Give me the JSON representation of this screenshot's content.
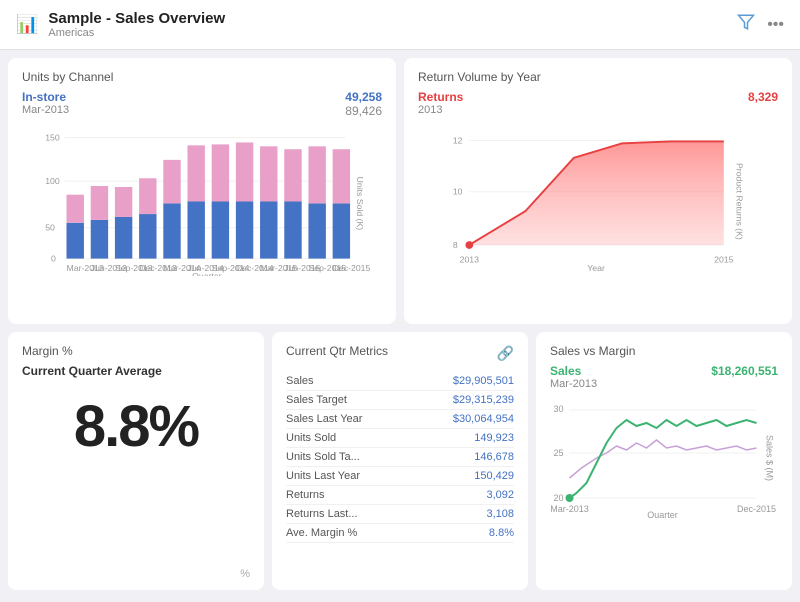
{
  "header": {
    "title": "Sample - Sales Overview",
    "subtitle": "Americas",
    "icon": "📊"
  },
  "unitsChannel": {
    "title": "Units by Channel",
    "series1": "In-store",
    "date1": "Mar-2013",
    "value1": "49,258",
    "value2": "89,426",
    "xLabels": [
      "Mar-2013",
      "Jun-2013",
      "Sep-2013",
      "Dec-2013",
      "Mar-2014",
      "Jun-2014",
      "Sep-2014",
      "Dec-2014",
      "Mar-2015",
      "Jun-2015",
      "Sep-2015",
      "Dec-2015"
    ],
    "yLabel": "Units Sold (K)",
    "xAxisLabel": "Quarter",
    "bars": [
      {
        "blue": 45,
        "pink": 35
      },
      {
        "blue": 48,
        "pink": 42
      },
      {
        "blue": 52,
        "pink": 38
      },
      {
        "blue": 55,
        "pink": 45
      },
      {
        "blue": 68,
        "pink": 55
      },
      {
        "blue": 72,
        "pink": 70
      },
      {
        "blue": 72,
        "pink": 72
      },
      {
        "blue": 72,
        "pink": 75
      },
      {
        "blue": 72,
        "pink": 68
      },
      {
        "blue": 72,
        "pink": 65
      },
      {
        "blue": 68,
        "pink": 72
      },
      {
        "blue": 68,
        "pink": 68
      }
    ],
    "yTicks": [
      "0",
      "50",
      "100",
      "150"
    ]
  },
  "returnVolume": {
    "title": "Return Volume by Year",
    "series": "Returns",
    "date": "2013",
    "value": "8,329",
    "xLabels": [
      "2013",
      "2015"
    ],
    "yLabel": "Product Returns (K)",
    "xAxisLabel": "Year",
    "yTicks": [
      "8",
      "10",
      "12"
    ]
  },
  "margin": {
    "title": "Margin %",
    "label": "Current Quarter Average",
    "value": "8.8%",
    "footer": "%"
  },
  "metrics": {
    "title": "Current Qtr Metrics",
    "rows": [
      {
        "label": "Sales",
        "value": "$29,905,501"
      },
      {
        "label": "Sales Target",
        "value": "$29,315,239"
      },
      {
        "label": "Sales Last Year",
        "value": "$30,064,954"
      },
      {
        "label": "Units Sold",
        "value": "149,923"
      },
      {
        "label": "Units Sold Ta...",
        "value": "146,678"
      },
      {
        "label": "Units Last Year",
        "value": "150,429"
      },
      {
        "label": "Returns",
        "value": "3,092"
      },
      {
        "label": "Returns Last...",
        "value": "3,108"
      },
      {
        "label": "Ave. Margin %",
        "value": "8.8%"
      }
    ]
  },
  "salesMargin": {
    "title": "Sales vs Margin",
    "series": "Sales",
    "date": "Mar-2013",
    "value": "$18,260,551",
    "xLabels": [
      "Mar-2013",
      "Dec-2015"
    ],
    "yLabel": "Sales $ (M)",
    "xAxisLabel": "Quarter",
    "yTicks": [
      "20",
      "25",
      "30"
    ]
  }
}
